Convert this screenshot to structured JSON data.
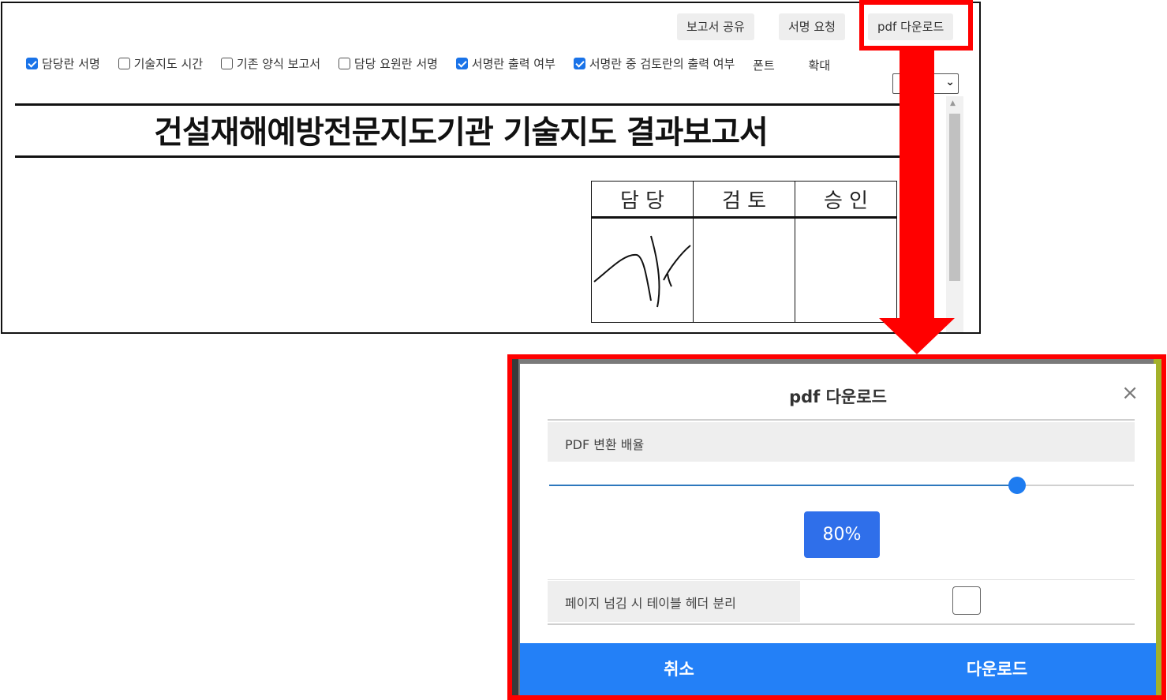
{
  "toolbar": {
    "share_label": "보고서 공유",
    "sign_request_label": "서명 요청",
    "pdf_download_label": "pdf 다운로드"
  },
  "options": [
    {
      "label": "담당란 서명",
      "checked": true
    },
    {
      "label": "기술지도 시간",
      "checked": false
    },
    {
      "label": "기존 양식 보고서",
      "checked": false
    },
    {
      "label": "담당 요원란 서명",
      "checked": false
    },
    {
      "label": "서명란 출력 여부",
      "checked": true
    },
    {
      "label": "서명란 중 검토란의 출력 여부",
      "checked": true
    }
  ],
  "extra_labels": {
    "font": "폰트",
    "zoom": "확대"
  },
  "document": {
    "title": "건설재해예방전문지도기관 기술지도 결과보고서",
    "sign_headers": [
      "담 당",
      "검 토",
      "승 인"
    ]
  },
  "highlight_color": "#ff0000",
  "modal": {
    "title": "pdf 다운로드",
    "close_symbol": "×",
    "scale_label": "PDF 변환 배율",
    "scale_value": "80%",
    "scale_fraction": 0.8,
    "split_label": "페이지 넘김 시 테이블 헤더 분리",
    "split_checked": false,
    "cancel_label": "취소",
    "download_label": "다운로드",
    "accent_color": "#2380f7"
  }
}
